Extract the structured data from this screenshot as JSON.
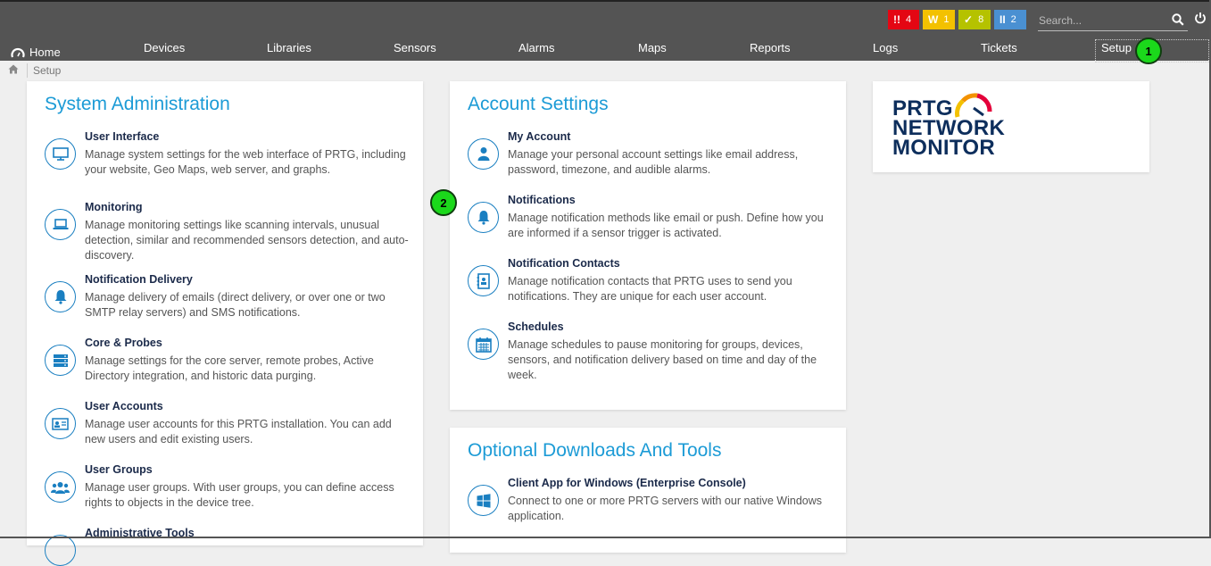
{
  "status_badges": [
    {
      "icon": "!!",
      "count": "4",
      "color": "#e40613"
    },
    {
      "icon": "W",
      "count": "1",
      "color": "#f3c100"
    },
    {
      "icon": "✓",
      "count": "8",
      "color": "#b5c200"
    },
    {
      "icon": "II",
      "count": "2",
      "color": "#4a90d2"
    }
  ],
  "search": {
    "placeholder": "Search..."
  },
  "nav": {
    "home": "Home",
    "items": [
      "Devices",
      "Libraries",
      "Sensors",
      "Alarms",
      "Maps",
      "Reports",
      "Logs",
      "Tickets"
    ],
    "setup": "Setup"
  },
  "breadcrumb": {
    "current": "Setup"
  },
  "system_admin": {
    "title": "System Administration",
    "items": [
      {
        "title": "User Interface",
        "desc": "Manage system settings for the web interface of PRTG, including your website, Geo Maps, web server, and graphs.",
        "icon": "monitor-icon"
      },
      {
        "title": "Monitoring",
        "desc": "Manage monitoring settings like scanning intervals, unusual detection, similar and recommended sensors detection, and auto-discovery.",
        "icon": "laptop-icon"
      },
      {
        "title": "Notification Delivery",
        "desc": "Manage delivery of emails (direct delivery, or over one or two SMTP relay servers) and SMS notifications.",
        "icon": "bell-icon"
      },
      {
        "title": "Core & Probes",
        "desc": "Manage settings for the core server, remote probes, Active Directory integration, and historic data purging.",
        "icon": "server-icon"
      },
      {
        "title": "User Accounts",
        "desc": "Manage user accounts for this PRTG installation. You can add new users and edit existing users.",
        "icon": "id-card-icon"
      },
      {
        "title": "User Groups",
        "desc": "Manage user groups. With user groups, you can define access rights to objects in the device tree.",
        "icon": "users-icon"
      },
      {
        "title": "Administrative Tools",
        "desc": "",
        "icon": "tools-icon"
      }
    ]
  },
  "account_settings": {
    "title": "Account Settings",
    "items": [
      {
        "title": "My Account",
        "desc": "Manage your personal account settings like email address, password, timezone, and audible alarms.",
        "icon": "user-icon"
      },
      {
        "title": "Notifications",
        "desc": "Manage notification methods like email or push. Define how you are informed if a sensor trigger is activated.",
        "icon": "bell-icon"
      },
      {
        "title": "Notification Contacts",
        "desc": "Manage notification contacts that PRTG uses to send you notifications. They are unique for each user account.",
        "icon": "address-book-icon"
      },
      {
        "title": "Schedules",
        "desc": "Manage schedules to pause monitoring for groups, devices, sensors, and notification delivery based on time and day of the week.",
        "icon": "calendar-icon"
      }
    ]
  },
  "optional_downloads": {
    "title": "Optional Downloads And Tools",
    "items": [
      {
        "title": "Client App for Windows (Enterprise Console)",
        "desc": "Connect to one or more PRTG servers with our native Windows application.",
        "icon": "windows-icon"
      }
    ]
  },
  "logo": {
    "line1": "PRTG",
    "line2": "NETWORK",
    "line3": "MONITOR"
  },
  "markers": [
    "1",
    "2"
  ]
}
